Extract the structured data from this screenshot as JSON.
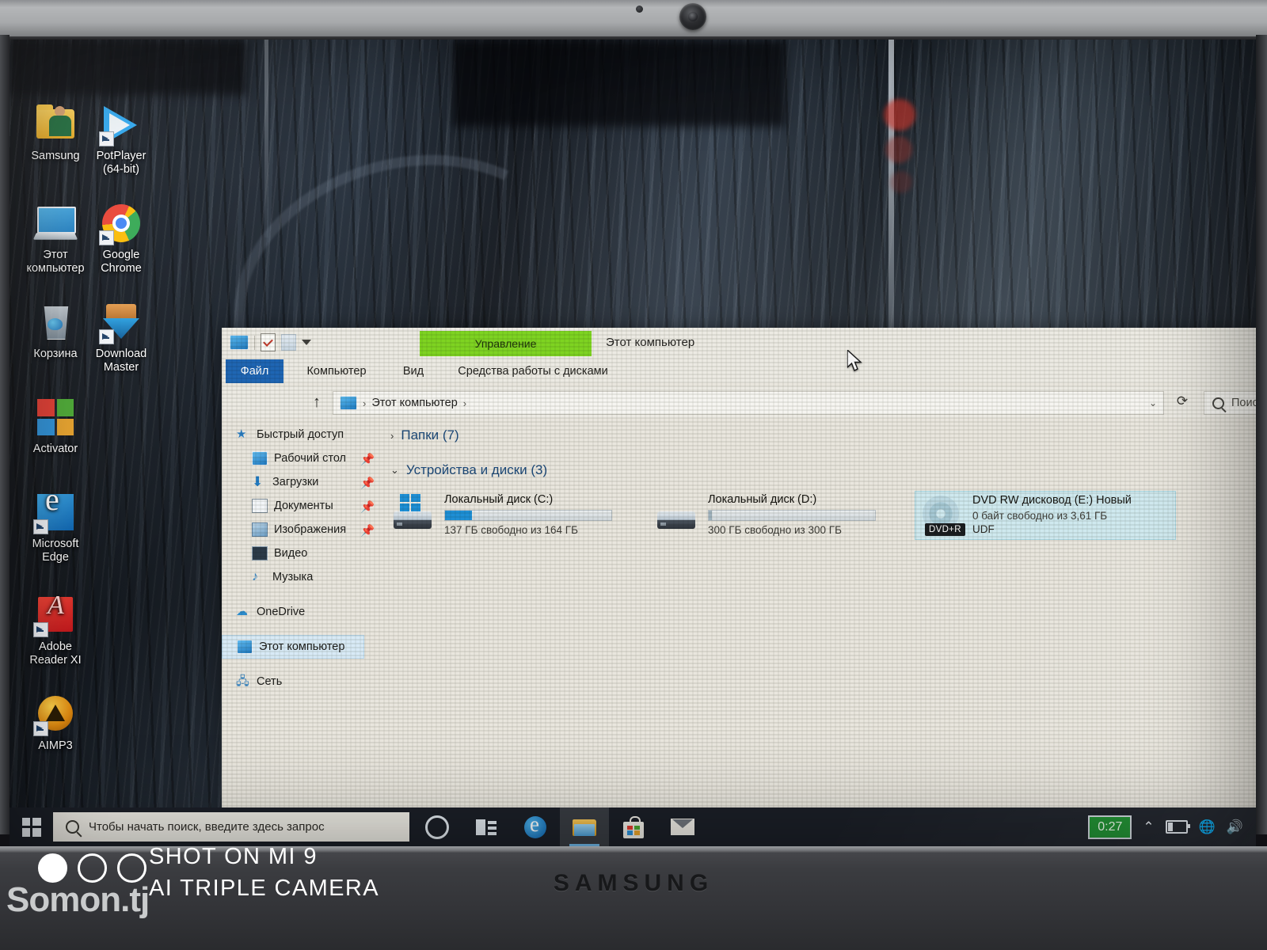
{
  "device": {
    "brand": "SAMSUNG"
  },
  "desktop": {
    "icons": [
      {
        "label": "Samsung",
        "icon": "folder-icon"
      },
      {
        "label": "PotPlayer\n(64-bit)",
        "label_line1": "PotPlayer",
        "label_line2": "(64-bit)",
        "icon": "potplayer-icon"
      },
      {
        "label": "Этот\nкомпьютер",
        "label_line1": "Этот",
        "label_line2": "компьютер",
        "icon": "this-pc-icon"
      },
      {
        "label": "Google\nChrome",
        "label_line1": "Google",
        "label_line2": "Chrome",
        "icon": "chrome-icon"
      },
      {
        "label": "Корзина",
        "icon": "recycle-bin-icon"
      },
      {
        "label": "Download\nMaster",
        "label_line1": "Download",
        "label_line2": "Master",
        "icon": "download-master-icon"
      },
      {
        "label": "Activator",
        "icon": "activator-icon"
      },
      {
        "label": "Microsoft\nEdge",
        "label_line1": "Microsoft",
        "label_line2": "Edge",
        "icon": "edge-icon"
      },
      {
        "label": "Adobe\nReader XI",
        "label_line1": "Adobe",
        "label_line2": "Reader XI",
        "icon": "adobe-reader-icon"
      },
      {
        "label": "AIMP3",
        "icon": "aimp-icon"
      }
    ]
  },
  "explorer": {
    "window_title": "Этот компьютер",
    "contextual_tab": "Управление",
    "contextual_tab_color": "#7ed321",
    "quick_access_toolbar": [
      "this-pc-icon",
      "properties-icon",
      "panel-icon",
      "customize-dropdown-icon"
    ],
    "tabs": [
      {
        "label": "Файл",
        "active": true
      },
      {
        "label": "Компьютер",
        "active": false
      },
      {
        "label": "Вид",
        "active": false
      },
      {
        "label": "Средства работы с дисками",
        "active": false
      }
    ],
    "address": {
      "up_icon": "↑",
      "root_icon": "this-pc-icon",
      "crumb": "Этот компьютер",
      "separator": "›",
      "dropdown": "⌄",
      "refresh": "⟳"
    },
    "search": {
      "placeholder": "Поиск: Этот компьютер"
    },
    "sidebar": [
      {
        "label": "Быстрый доступ",
        "icon": "star-icon",
        "indent": false,
        "pinned": false,
        "selected": false
      },
      {
        "label": "Рабочий стол",
        "icon": "desktop-icon",
        "indent": true,
        "pinned": true,
        "selected": false
      },
      {
        "label": "Загрузки",
        "icon": "downloads-icon",
        "indent": true,
        "pinned": true,
        "selected": false
      },
      {
        "label": "Документы",
        "icon": "documents-icon",
        "indent": true,
        "pinned": true,
        "selected": false
      },
      {
        "label": "Изображения",
        "icon": "pictures-icon",
        "indent": true,
        "pinned": true,
        "selected": false
      },
      {
        "label": "Видео",
        "icon": "videos-icon",
        "indent": true,
        "pinned": false,
        "selected": false
      },
      {
        "label": "Музыка",
        "icon": "music-icon",
        "indent": true,
        "pinned": false,
        "selected": false
      },
      {
        "label": "OneDrive",
        "icon": "onedrive-icon",
        "indent": false,
        "pinned": false,
        "selected": false
      },
      {
        "label": "Этот компьютер",
        "icon": "this-pc-icon",
        "indent": false,
        "pinned": false,
        "selected": true
      },
      {
        "label": "Сеть",
        "icon": "network-icon",
        "indent": false,
        "pinned": false,
        "selected": false
      }
    ],
    "groups": [
      {
        "title": "Папки (7)",
        "expanded": false,
        "chevron": "›"
      },
      {
        "title": "Устройства и диски (3)",
        "expanded": true,
        "chevron": "⌄"
      }
    ],
    "drives": [
      {
        "name": "Локальный диск (C:)",
        "free_text": "137 ГБ свободно из 164 ГБ",
        "free_gb": 137,
        "total_gb": 164,
        "used_percent": 16,
        "bar_color": "#1e8fd5",
        "icon": "hdd-windows-icon",
        "filesystem": "",
        "selected": false
      },
      {
        "name": "Локальный диск (D:)",
        "free_text": "300 ГБ свободно из 300 ГБ",
        "free_gb": 300,
        "total_gb": 300,
        "used_percent": 0,
        "bar_color": "#9fb2bd",
        "icon": "hdd-icon",
        "filesystem": "",
        "selected": false
      },
      {
        "name": "DVD RW дисковод (E:) Новый",
        "free_text": "0 байт свободно из 3,61 ГБ",
        "free_gb": 0,
        "total_gb": 3.61,
        "used_percent": 100,
        "bar_color": "#9fb2bd",
        "icon": "optical-drive-icon",
        "filesystem": "UDF",
        "media_badge": "DVD+R",
        "selected": true
      }
    ]
  },
  "taskbar": {
    "start": "windows-logo-icon",
    "search_placeholder": "Чтобы начать поиск, введите здесь запрос",
    "buttons": [
      {
        "name": "cortana-icon",
        "active": false
      },
      {
        "name": "task-view-icon",
        "active": false
      },
      {
        "name": "edge-icon",
        "active": false
      },
      {
        "name": "file-explorer-icon",
        "active": true
      },
      {
        "name": "microsoft-store-icon",
        "active": false
      },
      {
        "name": "mail-icon",
        "active": false
      }
    ],
    "tray": {
      "clock": "0:27",
      "chevron": "⌃",
      "battery": "battery-icon",
      "network": "🌐",
      "volume": "🔊"
    }
  },
  "watermark": {
    "line1": "SHOT ON MI 9",
    "line2": "AI TRIPLE CAMERA",
    "site": "Somon.tj"
  }
}
